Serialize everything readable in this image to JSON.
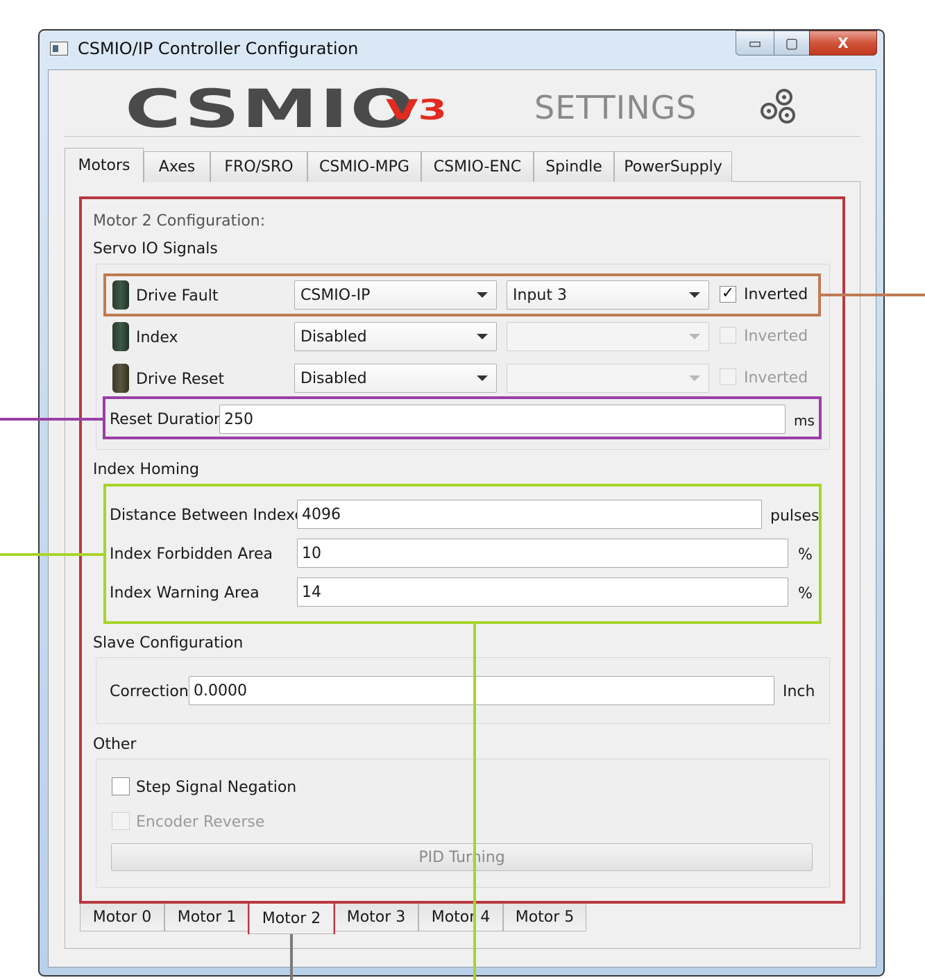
{
  "window": {
    "title": "CSMIO/IP Controller Configuration",
    "min_label": "▭",
    "max_label": "▢",
    "close_label": "X"
  },
  "header": {
    "logo_text": "CSMIO",
    "logo_version": "V3",
    "title": "SETTINGS"
  },
  "tabs": [
    {
      "label": "Motors",
      "active": true
    },
    {
      "label": "Axes"
    },
    {
      "label": "FRO/SRO"
    },
    {
      "label": "CSMIO-MPG"
    },
    {
      "label": "CSMIO-ENC"
    },
    {
      "label": "Spindle"
    },
    {
      "label": "PowerSupply"
    }
  ],
  "motor_config": {
    "heading": "Motor 2 Configuration:",
    "servo_io": {
      "title": "Servo IO Signals",
      "rows": [
        {
          "label": "Drive Fault",
          "source": "CSMIO-IP",
          "input": "Input 3",
          "inverted": true,
          "inverted_label": "Inverted",
          "check": "✓"
        },
        {
          "label": "Index",
          "source": "Disabled",
          "input": "",
          "inverted": false,
          "inverted_label": "Inverted",
          "check": ""
        },
        {
          "label": "Drive Reset",
          "source": "Disabled",
          "input": "",
          "inverted": false,
          "inverted_label": "Inverted",
          "check": ""
        }
      ],
      "reset_duration": {
        "label": "Reset Duration",
        "value": "250",
        "unit": "ms"
      }
    },
    "index_homing": {
      "title": "Index Homing",
      "distance": {
        "label": "Distance Between Indexes",
        "value": "4096",
        "unit": "pulses"
      },
      "forbidden": {
        "label": "Index Forbidden Area",
        "value": "10",
        "unit": "%"
      },
      "warning": {
        "label": "Index Warning Area",
        "value": "14",
        "unit": "%"
      }
    },
    "slave": {
      "title": "Slave Configuration",
      "correction": {
        "label": "Correction",
        "value": "0.0000",
        "unit": "Inch"
      }
    },
    "other": {
      "title": "Other",
      "step_signal_negation": {
        "label": "Step Signal Negation",
        "checked": false
      },
      "encoder_reverse": {
        "label": "Encoder Reverse",
        "checked": false,
        "disabled": true
      },
      "pid_button": "PID Turning"
    }
  },
  "motor_tabs": [
    {
      "label": "Motor 0"
    },
    {
      "label": "Motor 1"
    },
    {
      "label": "Motor 2",
      "active": true
    },
    {
      "label": "Motor 3"
    },
    {
      "label": "Motor 4"
    },
    {
      "label": "Motor 5"
    }
  ],
  "annotation_colors": {
    "motor_panel": "#b8383f",
    "drive_fault": "#bf7a52",
    "reset_duration": "#9a3fa6",
    "index_homing": "#a8d42a",
    "motor_tab_line": "#7a7a7a"
  }
}
